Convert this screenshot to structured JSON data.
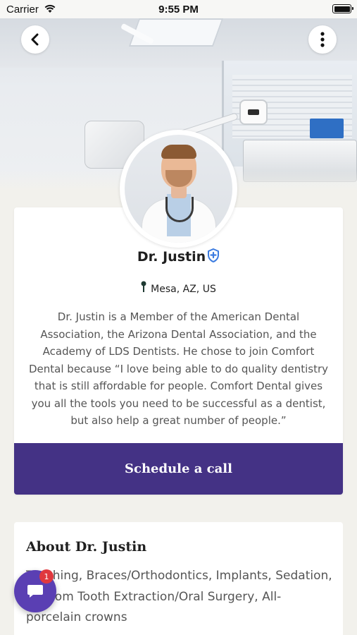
{
  "status_bar": {
    "carrier": "Carrier",
    "time": "9:55 PM"
  },
  "profile": {
    "name": "Dr. Justin",
    "location": "Mesa, AZ, US",
    "bio": "Dr. Justin is a Member of the American Dental Association, the Arizona Dental Association, and the Academy of LDS Dentists. He chose to join Comfort Dental because “I love being able to do quality dentistry that is still affordable for people. Comfort Dental gives you all the tools you need to be successful as a dentist, but also help a great number of people.”",
    "schedule_label": "Schedule a call"
  },
  "about": {
    "title": "About Dr. Justin",
    "services": "Teaching, Braces/Orthodontics, Implants, Sedation, Wisdom Tooth Extraction/Oral Surgery, All-porcelain crowns"
  },
  "chat": {
    "badge_count": "1"
  },
  "icons": {
    "back": "chevron-left-icon",
    "more": "more-vertical-icon",
    "verified": "verified-shield-icon",
    "location": "map-pin-icon",
    "chat": "chat-bubble-icon"
  },
  "colors": {
    "primary": "#443285",
    "chat": "#5a3fb3",
    "verified": "#3b7be0",
    "badge": "#e0383e"
  }
}
